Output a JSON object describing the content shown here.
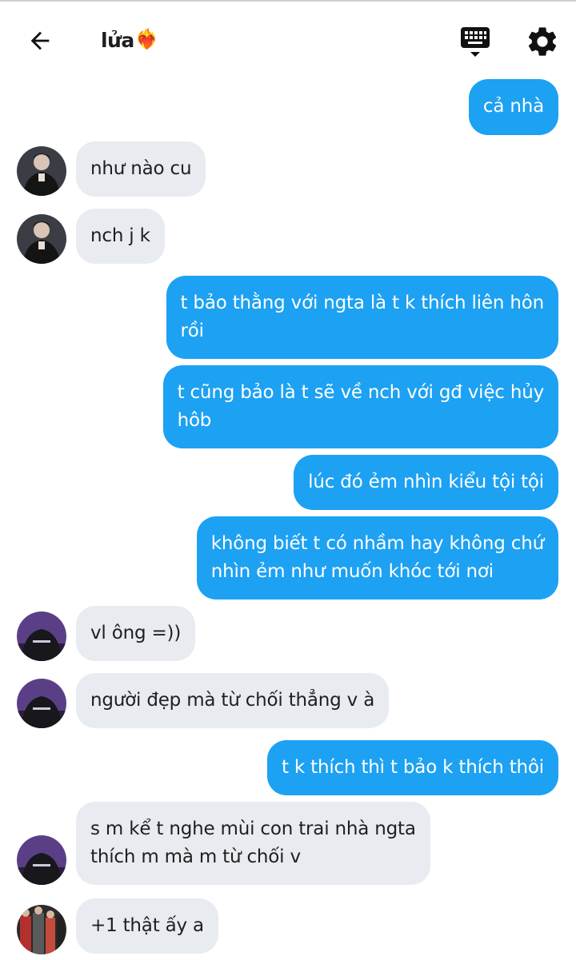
{
  "header": {
    "title": "lửa",
    "title_emoji": "❤️‍🔥",
    "back_icon": "arrow-left-icon",
    "keyboard_icon": "keyboard-icon",
    "settings_icon": "gear-icon"
  },
  "colors": {
    "outgoing_bubble": "#1da1f2",
    "incoming_bubble": "#e8ebef",
    "icon": "#111111"
  },
  "messages": [
    {
      "side": "out",
      "text": "cả nhà"
    },
    {
      "side": "in",
      "avatar": "avatar-dark-jacket",
      "text": "như nào cu"
    },
    {
      "side": "in",
      "avatar": "avatar-dark-jacket",
      "text": "nch j k"
    },
    {
      "side": "out",
      "text": "t bảo thằng với ngta là t k thích liên hôn\nrồi"
    },
    {
      "side": "out",
      "text": "t cũng bảo là t sẽ về nch với gđ việc hủy\nhôb"
    },
    {
      "side": "out",
      "text": "lúc đó ẻm nhìn kiểu tội tội"
    },
    {
      "side": "out",
      "text": "không biết t có nhầm hay không chứ\nnhìn ẻm như muốn khóc tới nơi"
    },
    {
      "side": "in",
      "avatar": "avatar-purple-back",
      "text": "vl ông =))"
    },
    {
      "side": "in",
      "avatar": "avatar-purple-back",
      "text": "người đẹp mà từ chối thẳng v à"
    },
    {
      "side": "out",
      "text": "t k thích thì t bảo k thích thôi"
    },
    {
      "side": "in",
      "avatar": "avatar-purple-back",
      "text": "s m kể t nghe mùi con trai nhà ngta\nthích m mà m từ chối v"
    },
    {
      "side": "in",
      "avatar": "avatar-colorful-group",
      "text": "+1 thật ấy a"
    }
  ]
}
